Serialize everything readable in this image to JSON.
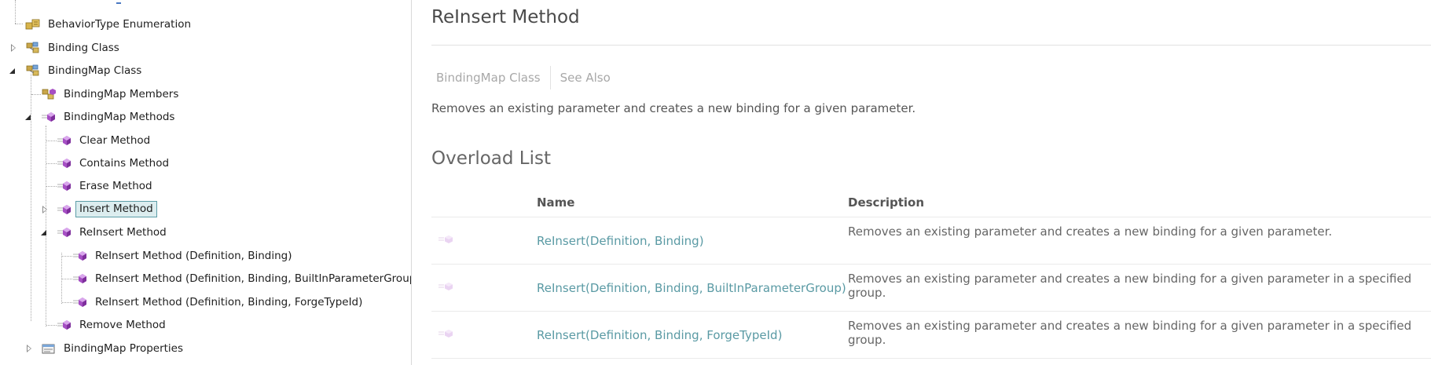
{
  "tree": {
    "items": [
      {
        "label": "BehaviorType Enumeration",
        "icon": "enumeration-icon"
      },
      {
        "label": "Binding Class",
        "icon": "class-icon"
      },
      {
        "label": "BindingMap Class",
        "icon": "class-icon"
      },
      {
        "label": "BindingMap Members",
        "icon": "members-icon"
      },
      {
        "label": "BindingMap Methods",
        "icon": "method-icon"
      },
      {
        "label": "Clear Method",
        "icon": "method-icon"
      },
      {
        "label": "Contains Method",
        "icon": "method-icon"
      },
      {
        "label": "Erase Method",
        "icon": "method-icon"
      },
      {
        "label": "Insert Method",
        "icon": "method-icon",
        "selected": true
      },
      {
        "label": "ReInsert Method",
        "icon": "method-icon"
      },
      {
        "label": "ReInsert Method (Definition, Binding)",
        "icon": "method-icon"
      },
      {
        "label": "ReInsert Method (Definition, Binding, BuiltInParameterGroup)",
        "icon": "method-icon"
      },
      {
        "label": "ReInsert Method (Definition, Binding, ForgeTypeId)",
        "icon": "method-icon"
      },
      {
        "label": "Remove Method",
        "icon": "method-icon"
      },
      {
        "label": "BindingMap Properties",
        "icon": "properties-icon"
      }
    ]
  },
  "page": {
    "title": "ReInsert Method",
    "tabs": [
      "BindingMap Class",
      "See Also"
    ],
    "summary": "Removes an existing parameter and creates a new binding for a given parameter.",
    "overload_heading": "Overload List"
  },
  "table": {
    "columns": [
      "",
      "Name",
      "Description"
    ],
    "rows": [
      {
        "icon": "public-method-icon",
        "name": "ReInsert(Definition, Binding)",
        "description": "Removes an existing parameter and creates a new binding for a given parameter."
      },
      {
        "icon": "public-method-icon",
        "name": "ReInsert(Definition, Binding, BuiltInParameterGroup)",
        "description": "Removes an existing parameter and creates a new binding for a given parameter in a specified group."
      },
      {
        "icon": "public-method-icon",
        "name": "ReInsert(Definition, Binding, ForgeTypeId)",
        "description": "Removes an existing parameter and creates a new binding for a given parameter in a specified group."
      }
    ]
  },
  "colors": {
    "link": "#5a9aa4",
    "selected_bg": "#dcedef",
    "selected_border": "#5d9ea8",
    "method_icon": "#a64fc4"
  }
}
